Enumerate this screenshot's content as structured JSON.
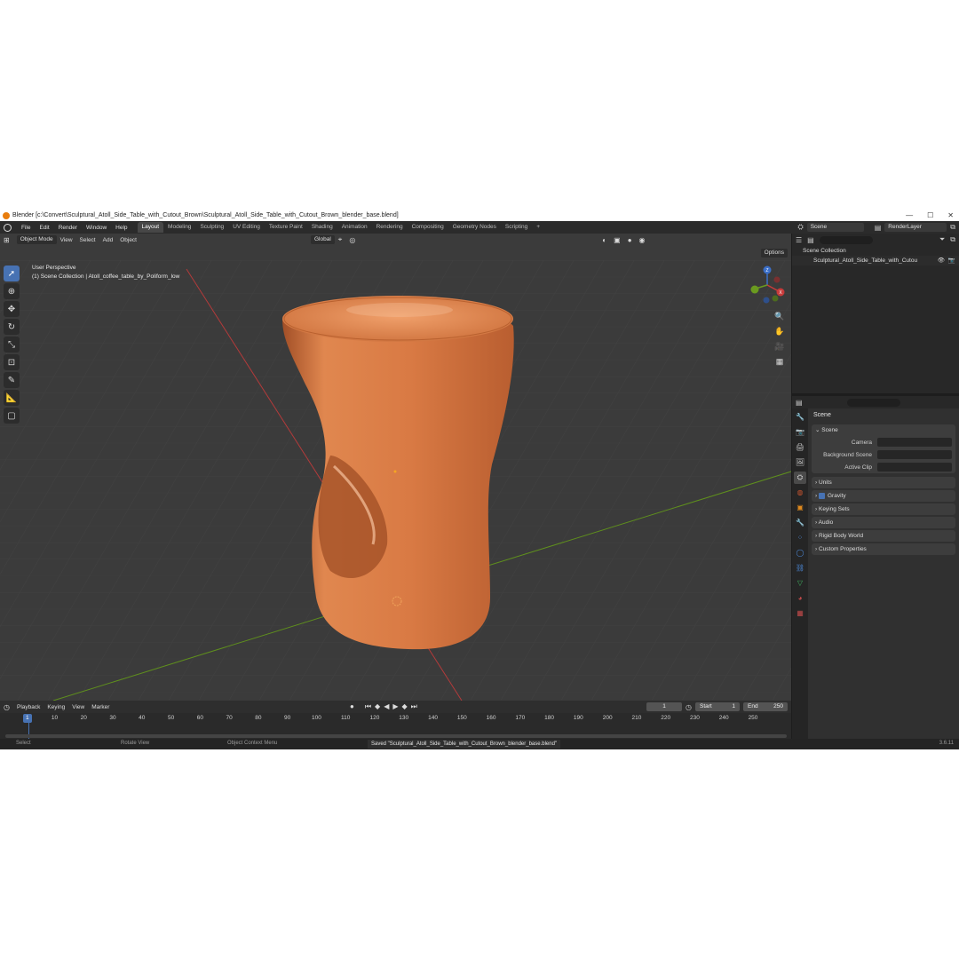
{
  "window": {
    "title": "Blender [c:\\Convert\\Sculptural_Atoll_Side_Table_with_Cutout_Brown\\Sculptural_Atoll_Side_Table_with_Cutout_Brown_blender_base.blend]",
    "controls": [
      "—",
      "☐",
      "✕"
    ]
  },
  "menu": {
    "items": [
      "File",
      "Edit",
      "Render",
      "Window",
      "Help"
    ],
    "tabs": [
      "Layout",
      "Modeling",
      "Sculpting",
      "UV Editing",
      "Texture Paint",
      "Shading",
      "Animation",
      "Rendering",
      "Compositing",
      "Geometry Nodes",
      "Scripting"
    ],
    "active_tab": "Layout",
    "add_tab": "+",
    "scene": "Scene",
    "render_layer": "RenderLayer"
  },
  "viewport": {
    "mode": "Object Mode",
    "menu": [
      "View",
      "Select",
      "Add",
      "Object"
    ],
    "transform": "Global",
    "info_line1": "User Perspective",
    "info_line2": "(1) Scene Collection | Atoll_coffee_table_by_Poliform_low",
    "options": "Options"
  },
  "timeline": {
    "menu": [
      "Playback",
      "Keying",
      "View",
      "Marker"
    ],
    "current_frame": "1",
    "start_label": "Start",
    "start": "1",
    "end_label": "End",
    "end": "250",
    "ticks": [
      "1",
      "10",
      "20",
      "30",
      "40",
      "50",
      "60",
      "70",
      "80",
      "90",
      "100",
      "110",
      "120",
      "130",
      "140",
      "150",
      "160",
      "170",
      "180",
      "190",
      "200",
      "210",
      "220",
      "230",
      "240",
      "250"
    ]
  },
  "status": {
    "select": "Select",
    "rotate": "Rotate View",
    "context": "Object Context Menu",
    "saved": "Saved \"Sculptural_Atoll_Side_Table_with_Cutout_Brown_blender_base.blend\"",
    "version": "3.6.11"
  },
  "outliner": {
    "root": "Scene Collection",
    "item": "Sculptural_Atoll_Side_Table_with_Cutou"
  },
  "properties": {
    "title": "Scene",
    "panel": "Scene",
    "camera_label": "Camera",
    "bg_label": "Background Scene",
    "clip_label": "Active Clip",
    "sections": [
      "Units",
      "Gravity",
      "Keying Sets",
      "Audio",
      "Rigid Body World",
      "Custom Properties"
    ]
  },
  "colors": {
    "accent": "#4772b3",
    "object": "#d9784a",
    "x_axis": "#c03636",
    "y_axis": "#6a9a1f"
  }
}
